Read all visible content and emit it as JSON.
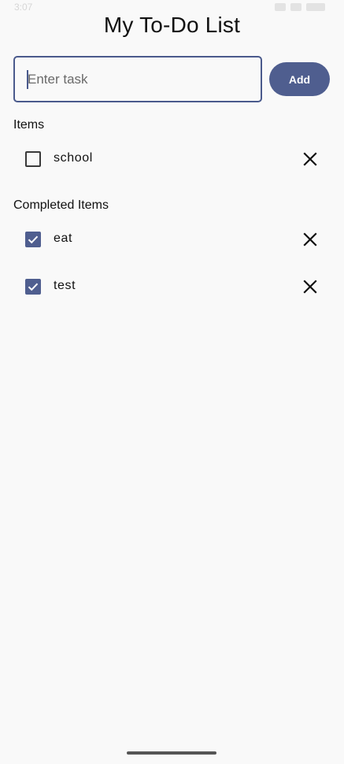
{
  "status_bar": {
    "time": "3:07"
  },
  "app": {
    "title": "My To-Do List"
  },
  "input": {
    "value": "",
    "placeholder": "Enter task"
  },
  "add_button": {
    "label": "Add"
  },
  "items_section": {
    "title": "Items",
    "items": [
      {
        "label": "school",
        "checked": false
      }
    ]
  },
  "completed_section": {
    "title": "Completed Items",
    "items": [
      {
        "label": "eat",
        "checked": true
      },
      {
        "label": "test",
        "checked": true
      }
    ]
  },
  "colors": {
    "accent": "#4f5e8f",
    "background": "#f9f9f9",
    "text": "#111111"
  },
  "icons": {
    "delete": "close-icon",
    "check": "check-icon"
  }
}
